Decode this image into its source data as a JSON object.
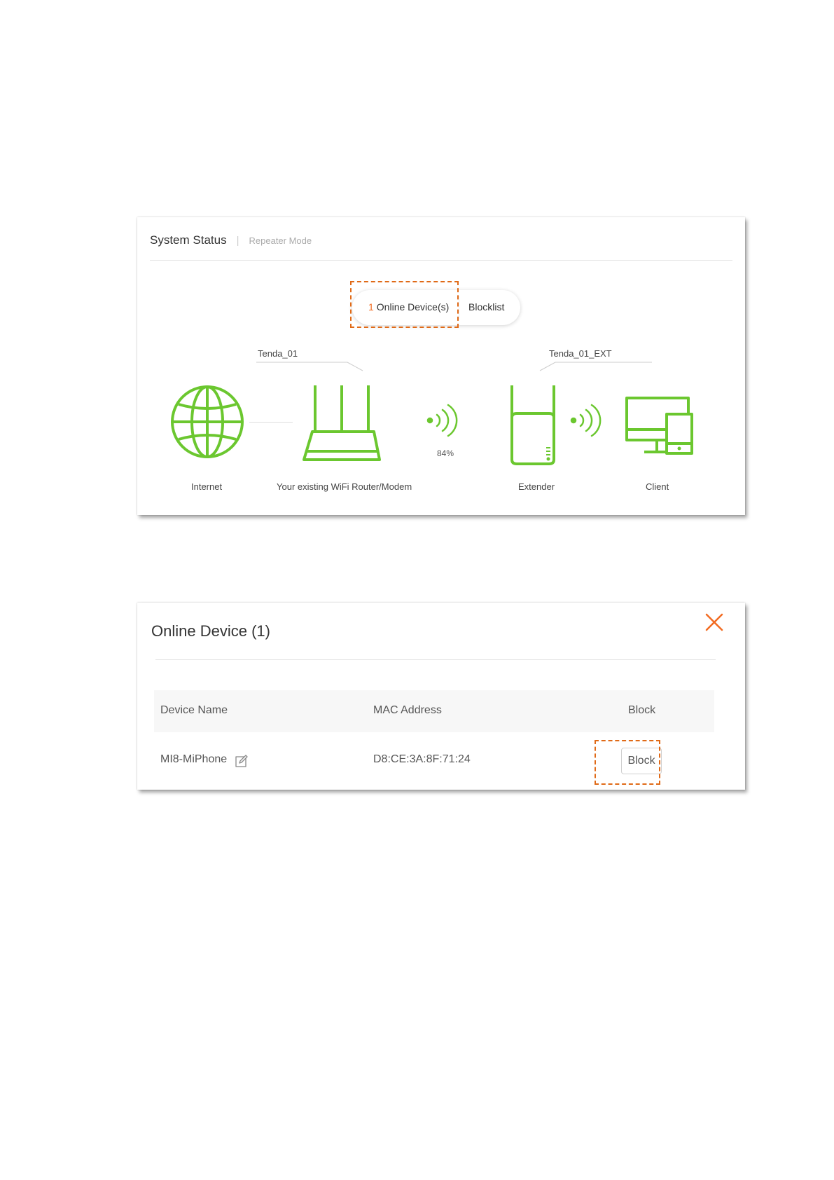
{
  "status_panel": {
    "title": "System Status",
    "separator": "|",
    "mode": "Repeater Mode",
    "online_count": "1",
    "online_label": "Online Device(s)",
    "blocklist_label": "Blocklist",
    "router_ssid": "Tenda_01",
    "extender_ssid": "Tenda_01_EXT",
    "signal_strength": "84%",
    "labels": {
      "internet": "Internet",
      "router": "Your existing WiFi Router/Modem",
      "extender": "Extender",
      "client": "Client"
    },
    "icon_color": "#6bc72f"
  },
  "device_dialog": {
    "title": "Online Device (1)",
    "columns": [
      "Device Name",
      "MAC Address",
      "Block"
    ],
    "rows": [
      {
        "device_name": "MI8-MiPhone",
        "mac": "D8:CE:3A:8F:71:24",
        "action": "Block"
      }
    ],
    "close_color": "#f26b21"
  },
  "highlight_color": "#e06a17"
}
